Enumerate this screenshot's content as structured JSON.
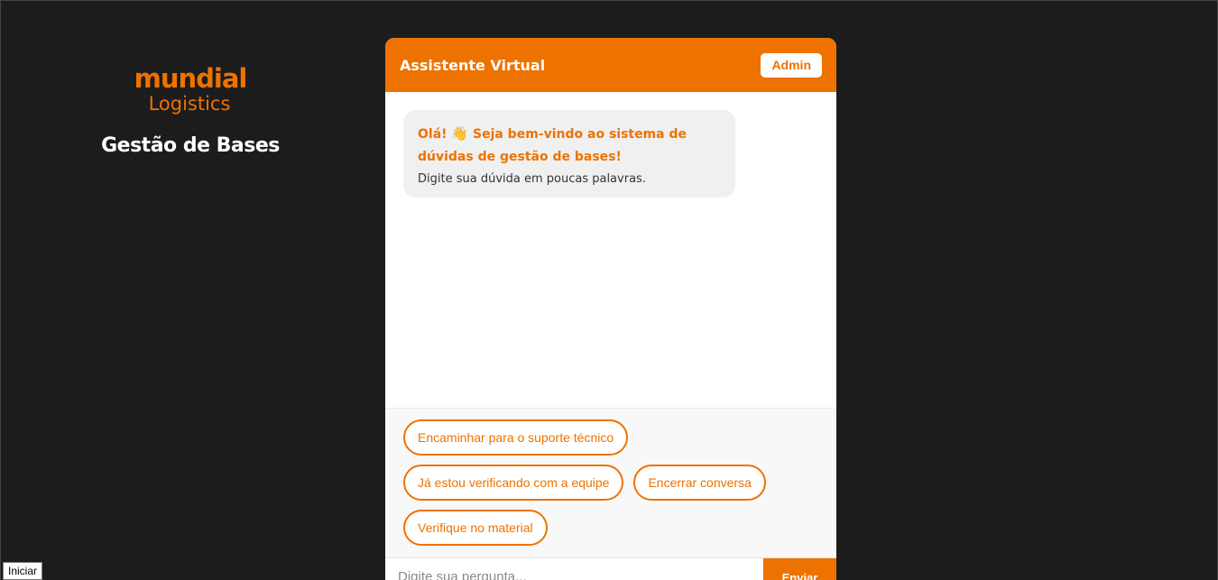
{
  "brand": {
    "logo_line1": "mundial",
    "logo_line2": "Logistics",
    "title": "Gestão de Bases"
  },
  "chat": {
    "title": "Assistente Virtual",
    "admin_label": "Admin",
    "welcome": {
      "wave_emoji": "👋",
      "title_before": "Olá!",
      "title_after": "Seja bem-vindo ao sistema de dúvidas de gestão de bases!",
      "text": "Digite sua dúvida em poucas palavras."
    },
    "quick_replies": [
      "Encaminhar para o suporte técnico",
      "Já estou verificando com a equipe",
      "Encerrar conversa",
      "Verifique no material"
    ],
    "input_placeholder": "Digite sua pergunta...",
    "send_label": "Enviar"
  },
  "taskbar": {
    "start_label": "Iniciar"
  },
  "colors": {
    "accent": "#ee7200",
    "background": "#1c1c1c",
    "bubble": "#f0f0f0"
  }
}
